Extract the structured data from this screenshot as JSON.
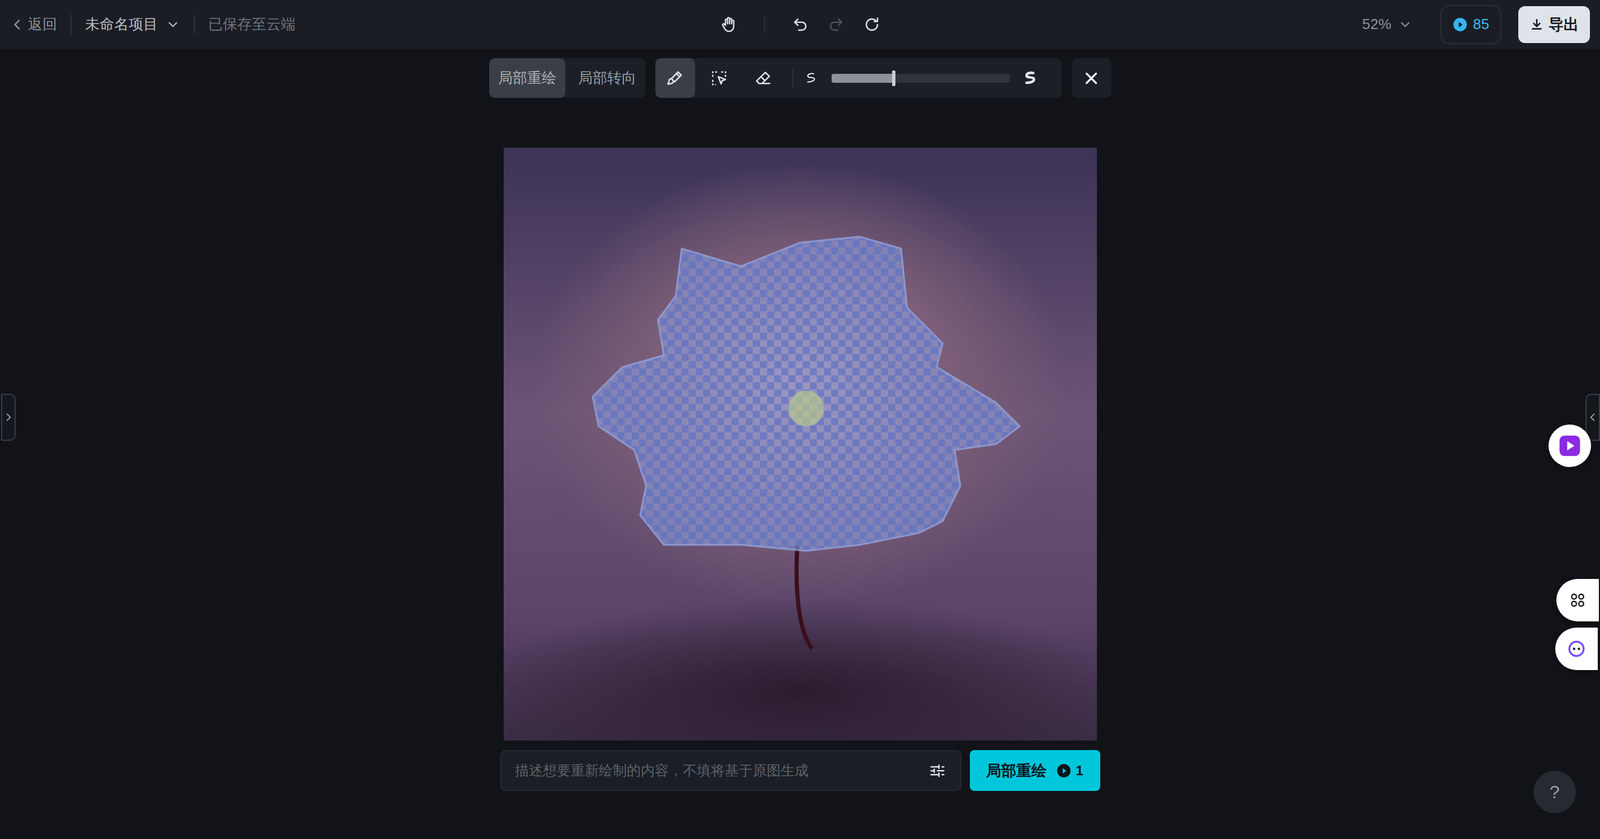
{
  "topbar": {
    "back": "返回",
    "project": "未命名项目",
    "save_status": "已保存至云端",
    "zoom": "52%",
    "credits": "85",
    "export": "导出"
  },
  "history": {
    "undo_disabled": false,
    "redo_disabled": true
  },
  "mode_tabs": [
    {
      "label": "局部重绘",
      "selected": true
    },
    {
      "label": "局部转向",
      "selected": false
    }
  ],
  "tools": [
    {
      "kind": "brush",
      "selected": true
    },
    {
      "kind": "select",
      "selected": false
    },
    {
      "kind": "eraser",
      "selected": false
    }
  ],
  "brush_size": {
    "level": 0.35
  },
  "prompt": {
    "placeholder": "描述想要重新绘制的内容，不填将基于原图生成"
  },
  "submit": {
    "label": "局部重绘",
    "cost": "1"
  },
  "help": "?"
}
